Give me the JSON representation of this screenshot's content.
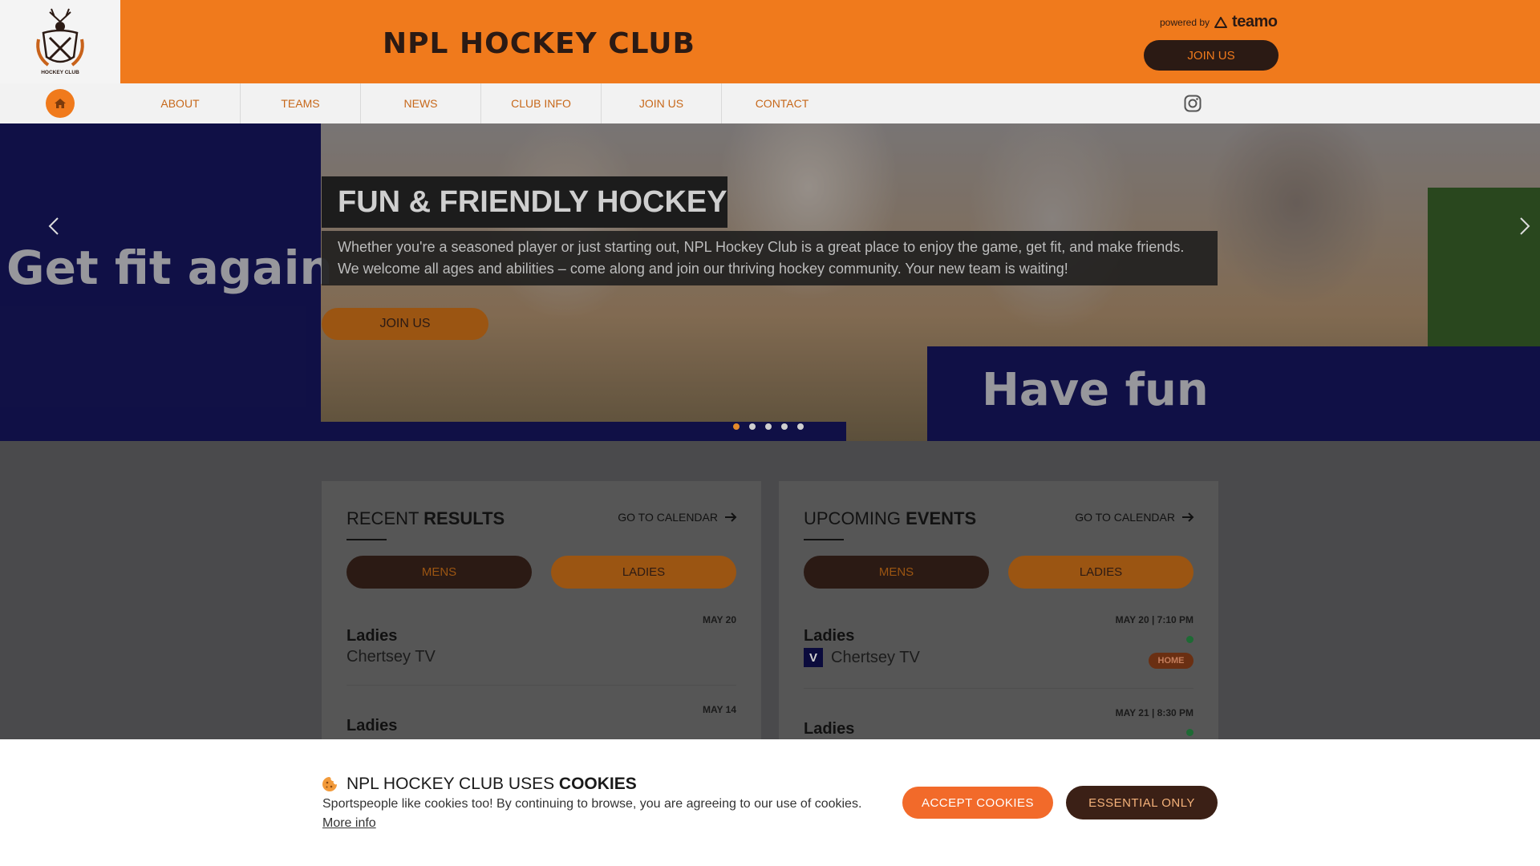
{
  "header": {
    "club_title": "NPL HOCKEY CLUB",
    "logo_caption": "HOCKEY CLUB",
    "powered_by": "powered by",
    "powered_brand": "teamo",
    "join_label": "JOIN US",
    "brand_color": "#f07a1c",
    "dark_color": "#2b1a14"
  },
  "nav": {
    "home_icon": "home-icon",
    "items": [
      "ABOUT",
      "TEAMS",
      "NEWS",
      "CLUB INFO",
      "JOIN US",
      "CONTACT"
    ],
    "social_icon": "instagram-icon"
  },
  "hero": {
    "image_text_left": "Get fit again",
    "image_text_right": "Have fun",
    "title": "FUN & FRIENDLY HOCKEY",
    "description": "Whether you're a seasoned player or just starting out, NPL Hockey Club is a great place to enjoy the game, get fit, and make friends. We welcome all ages and abilities – come along and join our thriving hockey community. Your new team is waiting!",
    "cta": "JOIN US",
    "slide_count": 5,
    "active_slide": 1
  },
  "results": {
    "title_light": "RECENT ",
    "title_bold": "RESULTS",
    "calendar_link": "GO TO CALENDAR",
    "tab_mens": "MENS",
    "tab_ladies": "LADIES",
    "items": [
      {
        "date": "MAY 20",
        "team": "Ladies",
        "opponent": "Chertsey TV"
      },
      {
        "date": "MAY 14",
        "team": "Ladies",
        "opponent": ""
      }
    ]
  },
  "events": {
    "title_light": "UPCOMING ",
    "title_bold": "EVENTS",
    "calendar_link": "GO TO CALENDAR",
    "tab_mens": "MENS",
    "tab_ladies": "LADIES",
    "items": [
      {
        "date": "MAY 20 | 7:10 PM",
        "team": "Ladies",
        "badge": "V",
        "opponent": "Chertsey TV",
        "venue": "HOME"
      },
      {
        "date": "MAY 21 | 8:30 PM",
        "team": "Ladies",
        "badge": "",
        "opponent": "",
        "venue": ""
      }
    ]
  },
  "cookie": {
    "title_light": "NPL HOCKEY CLUB USES ",
    "title_bold": "COOKIES",
    "text": "Sportspeople like cookies too! By continuing to browse, you are agreeing to our use of cookies.",
    "link": "More info",
    "accept": "ACCEPT COOKIES",
    "essential": "ESSENTIAL ONLY"
  }
}
